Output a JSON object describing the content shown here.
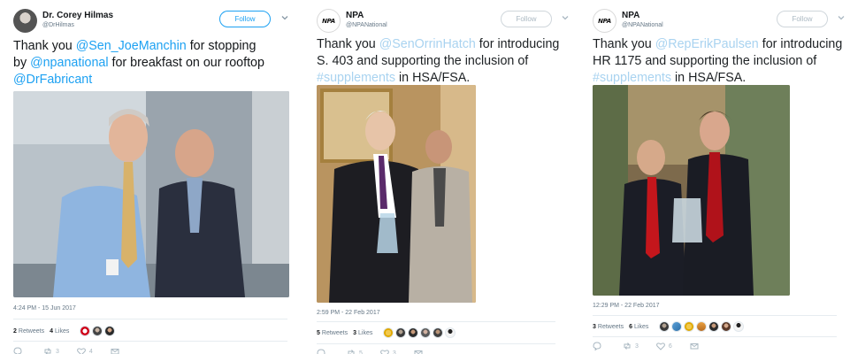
{
  "tweets": [
    {
      "name": "Dr. Corey Hilmas",
      "handle": "@DrHilmas",
      "follow_label": "Follow",
      "text_lines": [
        [
          {
            "t": "Thank you ",
            "m": false
          },
          {
            "t": "@Sen_JoeManchin",
            "m": true
          },
          {
            "t": " for stopping",
            "m": false
          }
        ],
        [
          {
            "t": "by ",
            "m": false
          },
          {
            "t": "@npanational",
            "m": true
          },
          {
            "t": " for breakfast on our rooftop",
            "m": false
          }
        ],
        [
          {
            "t": "@DrFabricant",
            "m": true
          }
        ]
      ],
      "timestamp": "4:24 PM - 15 Jun 2017",
      "retweets_count": "2",
      "retweets_label": "Retweets",
      "likes_count": "4",
      "likes_label": "Likes",
      "reply_count": "",
      "retweet_action_count": "3",
      "like_action_count": "4"
    },
    {
      "name": "NPA",
      "handle": "@NPANational",
      "follow_label": "Follow",
      "text_lines": [
        [
          {
            "t": "Thank you ",
            "m": false
          },
          {
            "t": "@SenOrrinHatch",
            "m": true
          },
          {
            "t": " for introducing",
            "m": false
          }
        ],
        [
          {
            "t": "S. 403 and supporting the inclusion of",
            "m": false
          }
        ],
        [
          {
            "t": "#supplements",
            "m": true
          },
          {
            "t": " in HSA/FSA.",
            "m": false
          }
        ]
      ],
      "timestamp": "2:59 PM - 22 Feb 2017",
      "retweets_count": "5",
      "retweets_label": "Retweets",
      "likes_count": "3",
      "likes_label": "Likes",
      "reply_count": "",
      "retweet_action_count": "5",
      "like_action_count": "3"
    },
    {
      "name": "NPA",
      "handle": "@NPANational",
      "follow_label": "Follow",
      "text_lines": [
        [
          {
            "t": "Thank you ",
            "m": false
          },
          {
            "t": "@RepErikPaulsen",
            "m": true
          },
          {
            "t": " for introducing",
            "m": false
          }
        ],
        [
          {
            "t": "HR 1175 and supporting the inclusion of",
            "m": false
          }
        ],
        [
          {
            "t": "#supplements",
            "m": true
          },
          {
            "t": " in HSA/FSA.",
            "m": false
          }
        ]
      ],
      "timestamp": "12:29 PM - 22 Feb 2017",
      "retweets_count": "3",
      "retweets_label": "Retweets",
      "likes_count": "6",
      "likes_label": "Likes",
      "reply_count": "",
      "retweet_action_count": "3",
      "like_action_count": "6"
    }
  ],
  "logo_text": "NPA",
  "colors": {
    "link_blue": "#1da1f2",
    "muted_link": "#a9d3f0",
    "meta_gray": "#657786"
  }
}
